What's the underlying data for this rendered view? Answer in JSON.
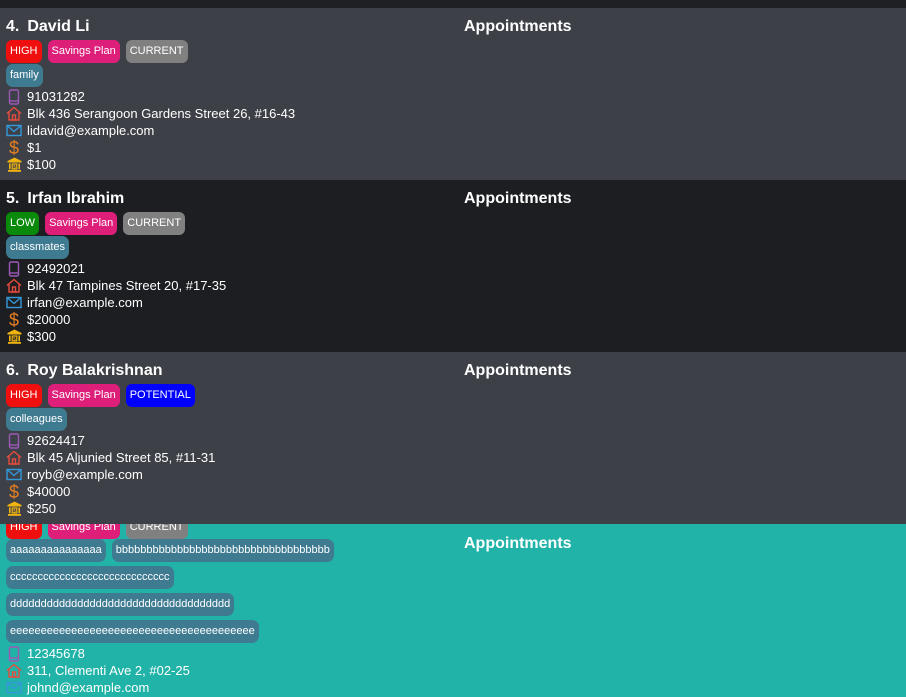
{
  "window": {
    "background": "#1e1f22"
  },
  "section_title": "Appointments",
  "colors": {
    "card_dark_gray": "#3d4046",
    "card_black": "#1d1e21",
    "card_selected": "#22b3a8",
    "high": "#f00f0f",
    "low": "#0a8a0a",
    "plan": "#dd1f7a",
    "current": "#808080",
    "potential": "#0000ff",
    "label_tag": "#3e7b91",
    "phone_icon": "#9b59b6",
    "home_icon": "#e74c3c",
    "mail_icon": "#3498db",
    "dollar_icon": "#e67e22",
    "bank_icon": "#f1b40f"
  },
  "cards": [
    {
      "index": "4.",
      "name": "David Li",
      "priority": "HIGH",
      "plan": "Savings Plan",
      "status": "CURRENT",
      "labels": [
        "family"
      ],
      "phone": "91031282",
      "address": "Blk 436 Serangoon Gardens Street 26, #16-43",
      "email": "lidavid@example.com",
      "income": "$1",
      "savings": "$100",
      "appointments_label": "Appointments"
    },
    {
      "index": "5.",
      "name": "Irfan Ibrahim",
      "priority": "LOW",
      "plan": "Savings Plan",
      "status": "CURRENT",
      "labels": [
        "classmates"
      ],
      "phone": "92492021",
      "address": "Blk 47 Tampines Street 20, #17-35",
      "email": "irfan@example.com",
      "income": "$20000",
      "savings": "$300",
      "appointments_label": "Appointments"
    },
    {
      "index": "6.",
      "name": "Roy Balakrishnan",
      "priority": "HIGH",
      "plan": "Savings Plan",
      "status": "POTENTIAL",
      "labels": [
        "colleagues"
      ],
      "phone": "92624417",
      "address": "Blk 45 Aljunied Street 85, #11-31",
      "email": "royb@example.com",
      "income": "$40000",
      "savings": "$250",
      "appointments_label": "Appointments"
    },
    {
      "priority": "HIGH",
      "plan": "Savings Plan",
      "status": "CURRENT",
      "labels": [
        "aaaaaaaaaaaaaaa",
        "bbbbbbbbbbbbbbbbbbbbbbbbbbbbbbbbbbb",
        "ccccccccccccccccccccccccccccc",
        "dddddddddddddddddddddddddddddddddddd",
        "eeeeeeeeeeeeeeeeeeeeeeeeeeeeeeeeeeeeeeee"
      ],
      "phone": "12345678",
      "address": "311, Clementi Ave 2, #02-25",
      "email": "johnd@example.com",
      "appointments_label": "Appointments"
    }
  ],
  "icons": {
    "phone": "phone-icon",
    "address": "home-icon",
    "email": "mail-icon",
    "income": "dollar-icon",
    "savings": "bank-icon"
  }
}
